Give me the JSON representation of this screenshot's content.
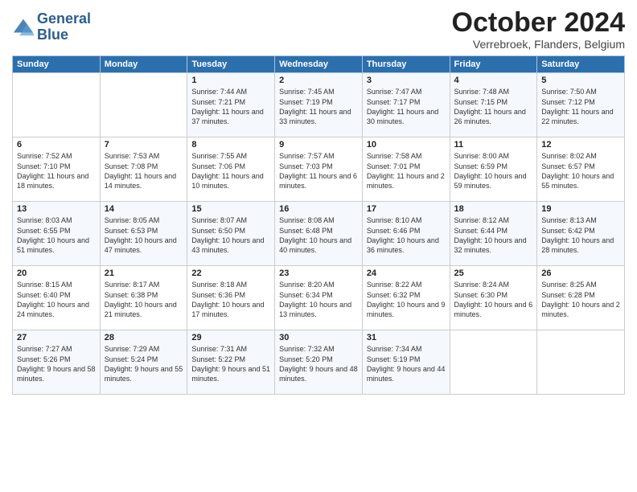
{
  "logo": {
    "line1": "General",
    "line2": "Blue"
  },
  "title": "October 2024",
  "location": "Verrebroek, Flanders, Belgium",
  "days_of_week": [
    "Sunday",
    "Monday",
    "Tuesday",
    "Wednesday",
    "Thursday",
    "Friday",
    "Saturday"
  ],
  "weeks": [
    [
      {
        "day": "",
        "sunrise": "",
        "sunset": "",
        "daylight": ""
      },
      {
        "day": "",
        "sunrise": "",
        "sunset": "",
        "daylight": ""
      },
      {
        "day": "1",
        "sunrise": "Sunrise: 7:44 AM",
        "sunset": "Sunset: 7:21 PM",
        "daylight": "Daylight: 11 hours and 37 minutes."
      },
      {
        "day": "2",
        "sunrise": "Sunrise: 7:45 AM",
        "sunset": "Sunset: 7:19 PM",
        "daylight": "Daylight: 11 hours and 33 minutes."
      },
      {
        "day": "3",
        "sunrise": "Sunrise: 7:47 AM",
        "sunset": "Sunset: 7:17 PM",
        "daylight": "Daylight: 11 hours and 30 minutes."
      },
      {
        "day": "4",
        "sunrise": "Sunrise: 7:48 AM",
        "sunset": "Sunset: 7:15 PM",
        "daylight": "Daylight: 11 hours and 26 minutes."
      },
      {
        "day": "5",
        "sunrise": "Sunrise: 7:50 AM",
        "sunset": "Sunset: 7:12 PM",
        "daylight": "Daylight: 11 hours and 22 minutes."
      }
    ],
    [
      {
        "day": "6",
        "sunrise": "Sunrise: 7:52 AM",
        "sunset": "Sunset: 7:10 PM",
        "daylight": "Daylight: 11 hours and 18 minutes."
      },
      {
        "day": "7",
        "sunrise": "Sunrise: 7:53 AM",
        "sunset": "Sunset: 7:08 PM",
        "daylight": "Daylight: 11 hours and 14 minutes."
      },
      {
        "day": "8",
        "sunrise": "Sunrise: 7:55 AM",
        "sunset": "Sunset: 7:06 PM",
        "daylight": "Daylight: 11 hours and 10 minutes."
      },
      {
        "day": "9",
        "sunrise": "Sunrise: 7:57 AM",
        "sunset": "Sunset: 7:03 PM",
        "daylight": "Daylight: 11 hours and 6 minutes."
      },
      {
        "day": "10",
        "sunrise": "Sunrise: 7:58 AM",
        "sunset": "Sunset: 7:01 PM",
        "daylight": "Daylight: 11 hours and 2 minutes."
      },
      {
        "day": "11",
        "sunrise": "Sunrise: 8:00 AM",
        "sunset": "Sunset: 6:59 PM",
        "daylight": "Daylight: 10 hours and 59 minutes."
      },
      {
        "day": "12",
        "sunrise": "Sunrise: 8:02 AM",
        "sunset": "Sunset: 6:57 PM",
        "daylight": "Daylight: 10 hours and 55 minutes."
      }
    ],
    [
      {
        "day": "13",
        "sunrise": "Sunrise: 8:03 AM",
        "sunset": "Sunset: 6:55 PM",
        "daylight": "Daylight: 10 hours and 51 minutes."
      },
      {
        "day": "14",
        "sunrise": "Sunrise: 8:05 AM",
        "sunset": "Sunset: 6:53 PM",
        "daylight": "Daylight: 10 hours and 47 minutes."
      },
      {
        "day": "15",
        "sunrise": "Sunrise: 8:07 AM",
        "sunset": "Sunset: 6:50 PM",
        "daylight": "Daylight: 10 hours and 43 minutes."
      },
      {
        "day": "16",
        "sunrise": "Sunrise: 8:08 AM",
        "sunset": "Sunset: 6:48 PM",
        "daylight": "Daylight: 10 hours and 40 minutes."
      },
      {
        "day": "17",
        "sunrise": "Sunrise: 8:10 AM",
        "sunset": "Sunset: 6:46 PM",
        "daylight": "Daylight: 10 hours and 36 minutes."
      },
      {
        "day": "18",
        "sunrise": "Sunrise: 8:12 AM",
        "sunset": "Sunset: 6:44 PM",
        "daylight": "Daylight: 10 hours and 32 minutes."
      },
      {
        "day": "19",
        "sunrise": "Sunrise: 8:13 AM",
        "sunset": "Sunset: 6:42 PM",
        "daylight": "Daylight: 10 hours and 28 minutes."
      }
    ],
    [
      {
        "day": "20",
        "sunrise": "Sunrise: 8:15 AM",
        "sunset": "Sunset: 6:40 PM",
        "daylight": "Daylight: 10 hours and 24 minutes."
      },
      {
        "day": "21",
        "sunrise": "Sunrise: 8:17 AM",
        "sunset": "Sunset: 6:38 PM",
        "daylight": "Daylight: 10 hours and 21 minutes."
      },
      {
        "day": "22",
        "sunrise": "Sunrise: 8:18 AM",
        "sunset": "Sunset: 6:36 PM",
        "daylight": "Daylight: 10 hours and 17 minutes."
      },
      {
        "day": "23",
        "sunrise": "Sunrise: 8:20 AM",
        "sunset": "Sunset: 6:34 PM",
        "daylight": "Daylight: 10 hours and 13 minutes."
      },
      {
        "day": "24",
        "sunrise": "Sunrise: 8:22 AM",
        "sunset": "Sunset: 6:32 PM",
        "daylight": "Daylight: 10 hours and 9 minutes."
      },
      {
        "day": "25",
        "sunrise": "Sunrise: 8:24 AM",
        "sunset": "Sunset: 6:30 PM",
        "daylight": "Daylight: 10 hours and 6 minutes."
      },
      {
        "day": "26",
        "sunrise": "Sunrise: 8:25 AM",
        "sunset": "Sunset: 6:28 PM",
        "daylight": "Daylight: 10 hours and 2 minutes."
      }
    ],
    [
      {
        "day": "27",
        "sunrise": "Sunrise: 7:27 AM",
        "sunset": "Sunset: 5:26 PM",
        "daylight": "Daylight: 9 hours and 58 minutes."
      },
      {
        "day": "28",
        "sunrise": "Sunrise: 7:29 AM",
        "sunset": "Sunset: 5:24 PM",
        "daylight": "Daylight: 9 hours and 55 minutes."
      },
      {
        "day": "29",
        "sunrise": "Sunrise: 7:31 AM",
        "sunset": "Sunset: 5:22 PM",
        "daylight": "Daylight: 9 hours and 51 minutes."
      },
      {
        "day": "30",
        "sunrise": "Sunrise: 7:32 AM",
        "sunset": "Sunset: 5:20 PM",
        "daylight": "Daylight: 9 hours and 48 minutes."
      },
      {
        "day": "31",
        "sunrise": "Sunrise: 7:34 AM",
        "sunset": "Sunset: 5:19 PM",
        "daylight": "Daylight: 9 hours and 44 minutes."
      },
      {
        "day": "",
        "sunrise": "",
        "sunset": "",
        "daylight": ""
      },
      {
        "day": "",
        "sunrise": "",
        "sunset": "",
        "daylight": ""
      }
    ]
  ]
}
